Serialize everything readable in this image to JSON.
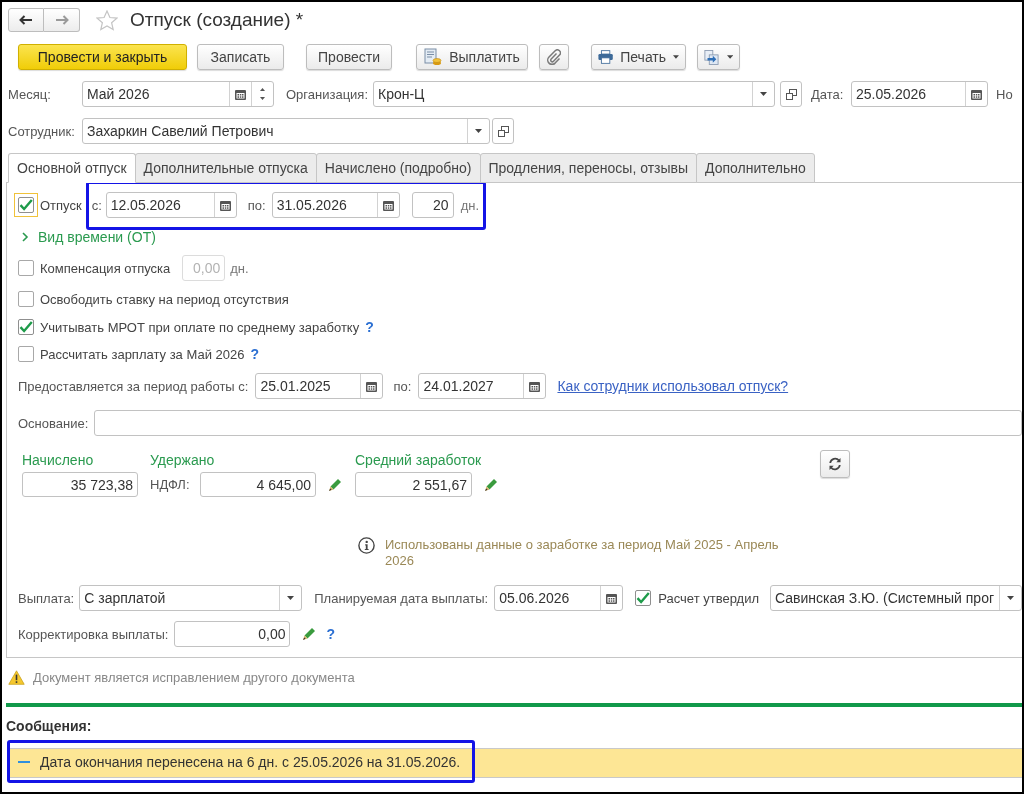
{
  "window": {
    "title": "Отпуск (создание) *",
    "favorite": false
  },
  "toolbar": [
    {
      "kind": "primary",
      "label": "Провести и закрыть",
      "menu": false
    },
    {
      "kind": "plain",
      "label": "Записать",
      "menu": false
    },
    {
      "kind": "plain",
      "label": "Провести",
      "menu": false
    },
    {
      "kind": "pay",
      "label": "Выплатить",
      "menu": false
    },
    {
      "kind": "attach",
      "menu": false
    },
    {
      "kind": "print",
      "label": "Печать",
      "menu": true
    },
    {
      "kind": "export",
      "menu": true
    }
  ],
  "header": {
    "month": {
      "label": "Месяц:",
      "value": "Май 2026"
    },
    "organization": {
      "label": "Организация:",
      "value": "Крон-Ц"
    },
    "date": {
      "label": "Дата:",
      "value": "25.05.2026"
    },
    "number": {
      "label": "Но"
    },
    "employee": {
      "label": "Сотрудник:",
      "value": "Захаркин Савелий Петрович"
    }
  },
  "tabs": [
    {
      "label": "Основной отпуск",
      "selected": true
    },
    {
      "label": "Дополнительные отпуска",
      "selected": false
    },
    {
      "label": "Начислено (подробно)",
      "selected": false
    },
    {
      "label": "Продления, переносы, отзывы",
      "selected": false
    },
    {
      "label": "Дополнительно",
      "selected": false
    }
  ],
  "vacation": {
    "label": "Отпуск",
    "checked": true,
    "focused": true,
    "highlighted": true,
    "from_label": "с:",
    "from": "12.05.2026",
    "to_label": "по:",
    "to": "31.05.2026",
    "days": "20",
    "days_unit": "дн."
  },
  "time_type": {
    "label": "Вид времени (ОТ)",
    "expanded": false
  },
  "compensation": {
    "label": "Компенсация отпуска",
    "checked": false,
    "value": "0,00",
    "unit": "дн.",
    "disabled": true
  },
  "options": [
    {
      "label": "Освободить ставку на период отсутствия",
      "checked": false
    },
    {
      "label": "Учитывать МРОТ при оплате по среднему заработку",
      "checked": true,
      "help": "?"
    },
    {
      "label": "Рассчитать зарплату за Май 2026",
      "checked": false,
      "help": "?"
    }
  ],
  "work_period": {
    "label": "Предоставляется за период работы с:",
    "from": "25.01.2025",
    "to_label": "по:",
    "to": "24.01.2027",
    "link": "Как сотрудник использовал отпуск?"
  },
  "basis": {
    "label": "Основание:"
  },
  "totals": {
    "accrued": {
      "title": "Начислено",
      "value": "35 723,38"
    },
    "withheld": {
      "title": "Удержано",
      "label": "НДФЛ:",
      "value": "4 645,00"
    },
    "average": {
      "title": "Средний заработок",
      "value": "2 551,67"
    }
  },
  "info": "Использованы данные о заработке за период Май 2025 - Апрель 2026",
  "payment": {
    "label": "Выплата:",
    "value": "С зарплатой",
    "date_label": "Планируемая дата выплаты:",
    "date": "05.06.2026",
    "approved": true,
    "approved_label": "Расчет утвердил",
    "approver": "Савинская З.Ю. (Системный прог"
  },
  "correction": {
    "label": "Корректировка выплаты:",
    "value": "0,00",
    "help": "?"
  },
  "warning": "Документ является исправлением другого документа",
  "messages": {
    "title": "Сообщения:",
    "items": [
      {
        "text": "Дата окончания перенесена на 6 дн. с 25.05.2026 на 31.05.2026.",
        "highlighted": true
      }
    ]
  }
}
